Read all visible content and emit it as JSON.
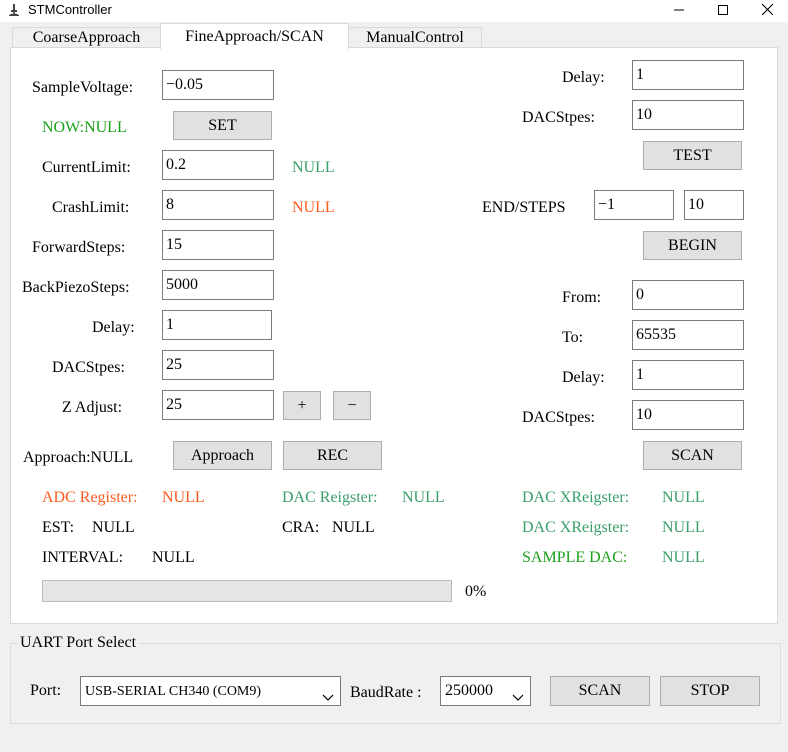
{
  "window": {
    "title": "STMController",
    "app_icon": "microscope-icon",
    "buttons": [
      "minimize-icon",
      "maximize-icon",
      "close-icon"
    ]
  },
  "tabs": [
    {
      "label": "CoarseApproach",
      "active": false
    },
    {
      "label": "FineApproach/SCAN",
      "active": true
    },
    {
      "label": "ManualControl",
      "active": false
    }
  ],
  "left": {
    "sample_voltage": {
      "label": "SampleVoltage:",
      "value": "−0.05"
    },
    "now_status": "NOW:NULL",
    "set_button": "SET",
    "current_limit": {
      "label": "CurrentLimit:",
      "value": "0.2",
      "status": "NULL"
    },
    "crash_limit": {
      "label": "CrashLimit:",
      "value": "8",
      "status": "NULL"
    },
    "forward_steps": {
      "label": "ForwardSteps:",
      "value": "15"
    },
    "back_piezo_steps": {
      "label": "BackPiezoSteps:",
      "value": "5000"
    },
    "delay": {
      "label": "Delay:",
      "value": "1"
    },
    "dac_steps": {
      "label": "DACStpes:",
      "value": "25"
    },
    "z_adjust": {
      "label": "Z Adjust:",
      "value": "25",
      "plus": "+",
      "minus": "−"
    },
    "approach_status": "Approach:NULL",
    "approach_button": "Approach",
    "rec_button": "REC"
  },
  "right": {
    "test_delay": {
      "label": "Delay:",
      "value": "1"
    },
    "test_dac_steps": {
      "label": "DACStpes:",
      "value": "10"
    },
    "test_button": "TEST",
    "end_steps": {
      "label": "END/STEPS",
      "end": "−1",
      "steps": "10"
    },
    "begin_button": "BEGIN",
    "scan_from": {
      "label": "From:",
      "value": "0"
    },
    "scan_to": {
      "label": "To:",
      "value": "65535"
    },
    "scan_delay": {
      "label": "Delay:",
      "value": "1"
    },
    "scan_dac_steps": {
      "label": "DACStpes:",
      "value": "10"
    },
    "scan_button": "SCAN"
  },
  "registers": {
    "adc": {
      "label": "ADC Register:",
      "value": "NULL"
    },
    "dac": {
      "label": "DAC Reigster:",
      "value": "NULL"
    },
    "dac_x1": {
      "label": "DAC XReigster:",
      "value": "NULL"
    },
    "est": {
      "label": "EST:",
      "value": "NULL"
    },
    "cra": {
      "label": "CRA:",
      "value": "NULL"
    },
    "dac_x2": {
      "label": "DAC XReigster:",
      "value": "NULL"
    },
    "interval": {
      "label": "INTERVAL:",
      "value": "NULL"
    },
    "sample_dac": {
      "label": "SAMPLE DAC:",
      "value": "NULL"
    }
  },
  "progress": {
    "value": 0,
    "label": "0%"
  },
  "uart": {
    "group_title": "UART Port Select",
    "port_label": "Port:",
    "port_value": "USB-SERIAL CH340 (COM9)",
    "baud_label": "BaudRate :",
    "baud_value": "250000",
    "scan_button": "SCAN",
    "stop_button": "STOP"
  },
  "colors": {
    "green": "#1aa11a",
    "teal": "#3a9e6a",
    "orange": "#ff5a1f",
    "panel_bg": "#ffffff",
    "window_bg": "#f0f0f0",
    "button_bg": "#e1e1e1"
  }
}
